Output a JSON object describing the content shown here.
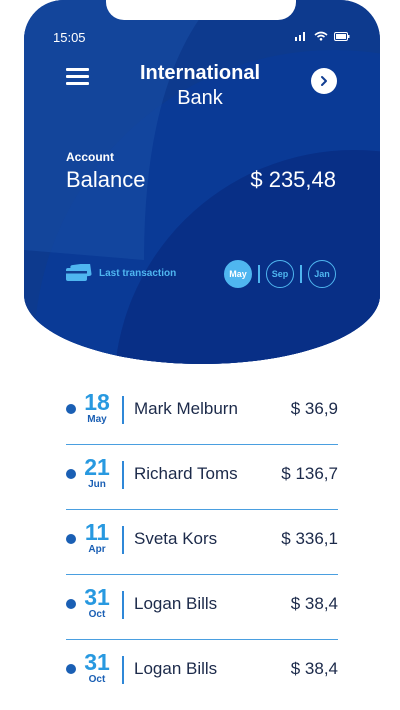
{
  "status_bar": {
    "time": "15:05"
  },
  "header": {
    "title_line1": "International",
    "title_line2": "Bank"
  },
  "account": {
    "label": "Account",
    "balance_label": "Balance",
    "balance_value": "$ 235,48"
  },
  "last_transaction": {
    "label": "Last transaction",
    "months": [
      "May",
      "Sep",
      "Jan"
    ],
    "selected_month": "May"
  },
  "transactions": [
    {
      "day": "18",
      "month": "May",
      "name": "Mark Melburn",
      "amount": "$ 36,9"
    },
    {
      "day": "21",
      "month": "Jun",
      "name": "Richard Toms",
      "amount": "$ 136,7"
    },
    {
      "day": "11",
      "month": "Apr",
      "name": "Sveta Kors",
      "amount": "$ 336,1"
    },
    {
      "day": "31",
      "month": "Oct",
      "name": "Logan Bills",
      "amount": "$ 38,4"
    },
    {
      "day": "31",
      "month": "Oct",
      "name": "Logan Bills",
      "amount": "$ 38,4"
    }
  ],
  "colors": {
    "header_dark": "#123e92",
    "header_light": "#0f4fa8",
    "accent": "#4fb6f0",
    "text_dark": "#1c2a4a"
  }
}
